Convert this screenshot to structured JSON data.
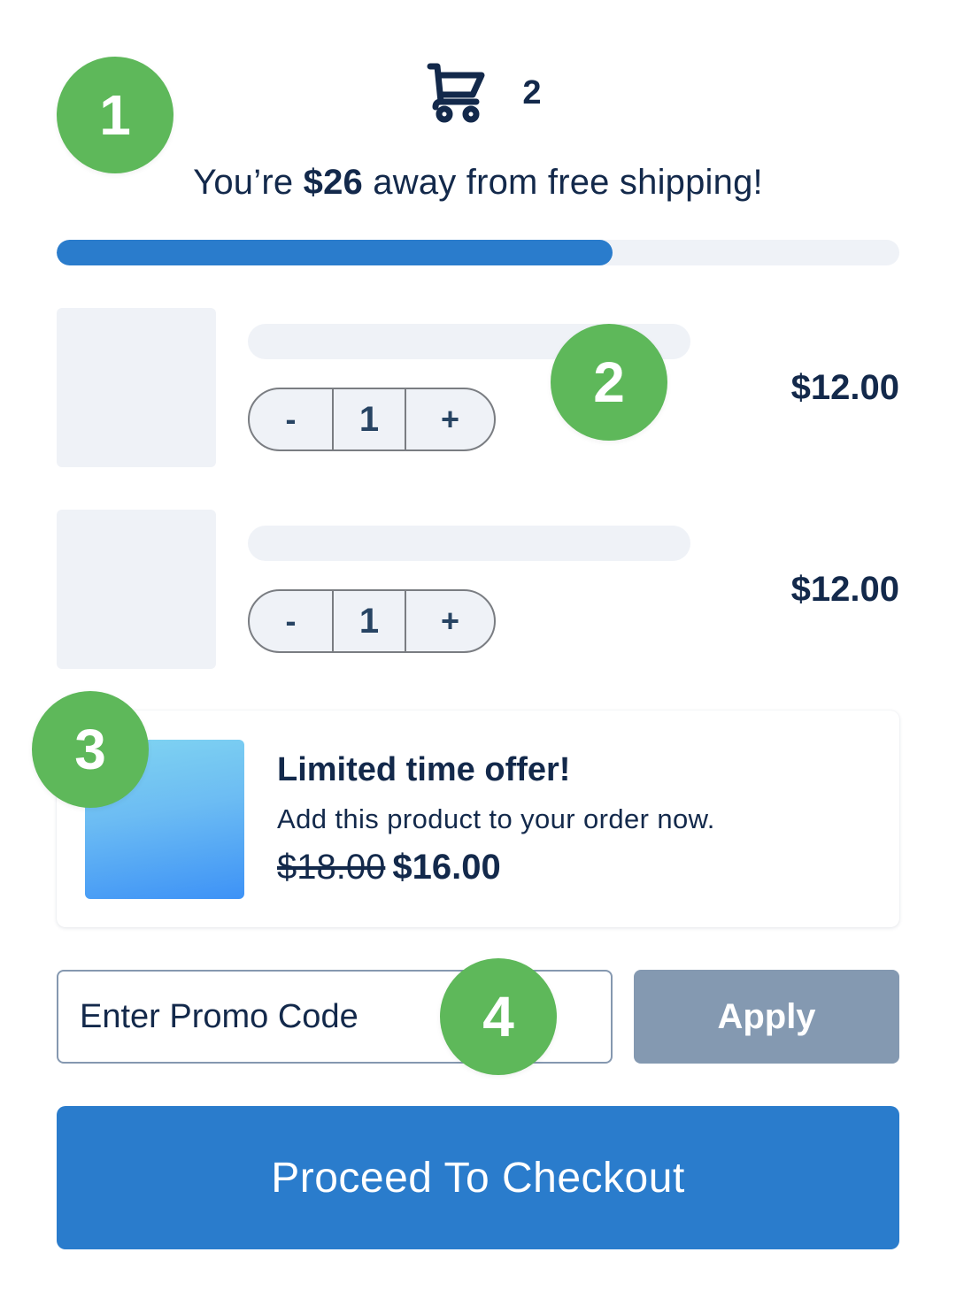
{
  "header": {
    "cart_icon": "shopping-cart-icon",
    "cart_count": "2"
  },
  "shipping": {
    "prefix": "You’re ",
    "amount": "$26",
    "suffix": " away from free shipping!",
    "progress_percent": 66,
    "colors": {
      "fill": "#2a7ccc",
      "track": "#eff2f7"
    }
  },
  "cart": {
    "items": [
      {
        "quantity": "1",
        "price": "$12.00",
        "minus_label": "-",
        "plus_label": "+"
      },
      {
        "quantity": "1",
        "price": "$12.00",
        "minus_label": "-",
        "plus_label": "+"
      }
    ]
  },
  "offer": {
    "title": "Limited time offer!",
    "description": "Add this product to your order now.",
    "old_price": "$18.00",
    "new_price": "$16.00"
  },
  "promo": {
    "placeholder": "Enter Promo Code",
    "value": "",
    "apply_label": "Apply"
  },
  "checkout": {
    "label": "Proceed To Checkout",
    "color": "#2a7ccc"
  },
  "markers": [
    "1",
    "2",
    "3",
    "4"
  ],
  "colors": {
    "text": "#13294b",
    "marker_green": "#5eb85a",
    "apply_disabled": "#8499b1"
  }
}
